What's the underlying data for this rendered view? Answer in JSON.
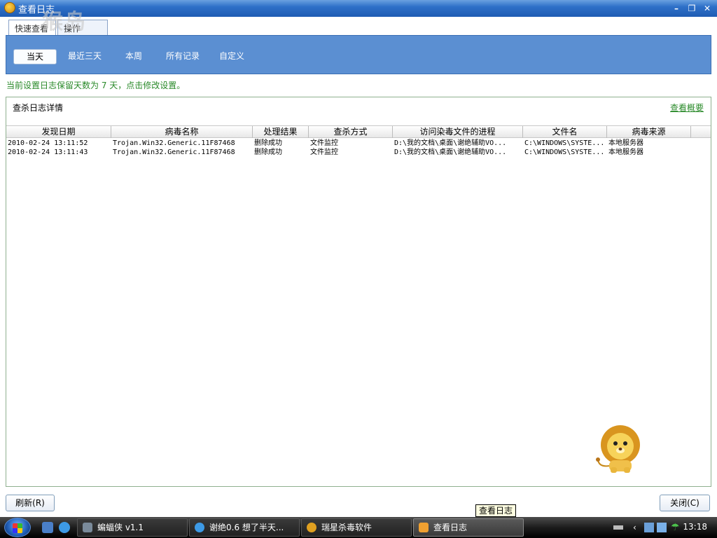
{
  "window": {
    "title": "查看日志"
  },
  "watermark": {
    "chars": "猴岛",
    "url": "bbs.houdao.com"
  },
  "top_tabs": [
    {
      "label": "快速查看"
    },
    {
      "label": "操作"
    }
  ],
  "filter_tabs": [
    {
      "label": "当天",
      "active": true
    },
    {
      "label": "最近三天",
      "active": false
    },
    {
      "label": "本周",
      "active": false
    },
    {
      "label": "所有记录",
      "active": false
    },
    {
      "label": "自定义",
      "active": false
    }
  ],
  "info_line": "当前设置日志保留天数为 7 天，点击修改设置。",
  "panel": {
    "title": "查杀日志详情",
    "link": "查看概要"
  },
  "table": {
    "columns": [
      "发现日期",
      "病毒名称",
      "处理结果",
      "查杀方式",
      "访问染毒文件的进程",
      "文件名",
      "病毒来源"
    ],
    "rows": [
      [
        "2010-02-24 13:11:52",
        "Trojan.Win32.Generic.11F87468",
        "删除成功",
        "文件监控",
        "D:\\我的文档\\桌面\\谢绝辅助VO...",
        "C:\\WINDOWS\\SYSTE...",
        "本地服务器"
      ],
      [
        "2010-02-24 13:11:43",
        "Trojan.Win32.Generic.11F87468",
        "删除成功",
        "文件监控",
        "D:\\我的文档\\桌面\\谢绝辅助VO...",
        "C:\\WINDOWS\\SYSTE...",
        "本地服务器"
      ]
    ]
  },
  "buttons": {
    "refresh": "刷新(R)",
    "close": "关闭(C)"
  },
  "tooltip": "查看日志",
  "taskbar": {
    "items": [
      {
        "label": "蝙蝠侠 v1.1",
        "active": false
      },
      {
        "label": "谢绝0.6  想了半天...",
        "active": false
      },
      {
        "label": "瑞星杀毒软件",
        "active": false
      },
      {
        "label": "查看日志",
        "active": true
      }
    ],
    "clock": "13:18"
  },
  "colors": {
    "accent": "#5b8fd2",
    "info_green": "#2a8a2a",
    "titlebar": "#2e70c8"
  }
}
